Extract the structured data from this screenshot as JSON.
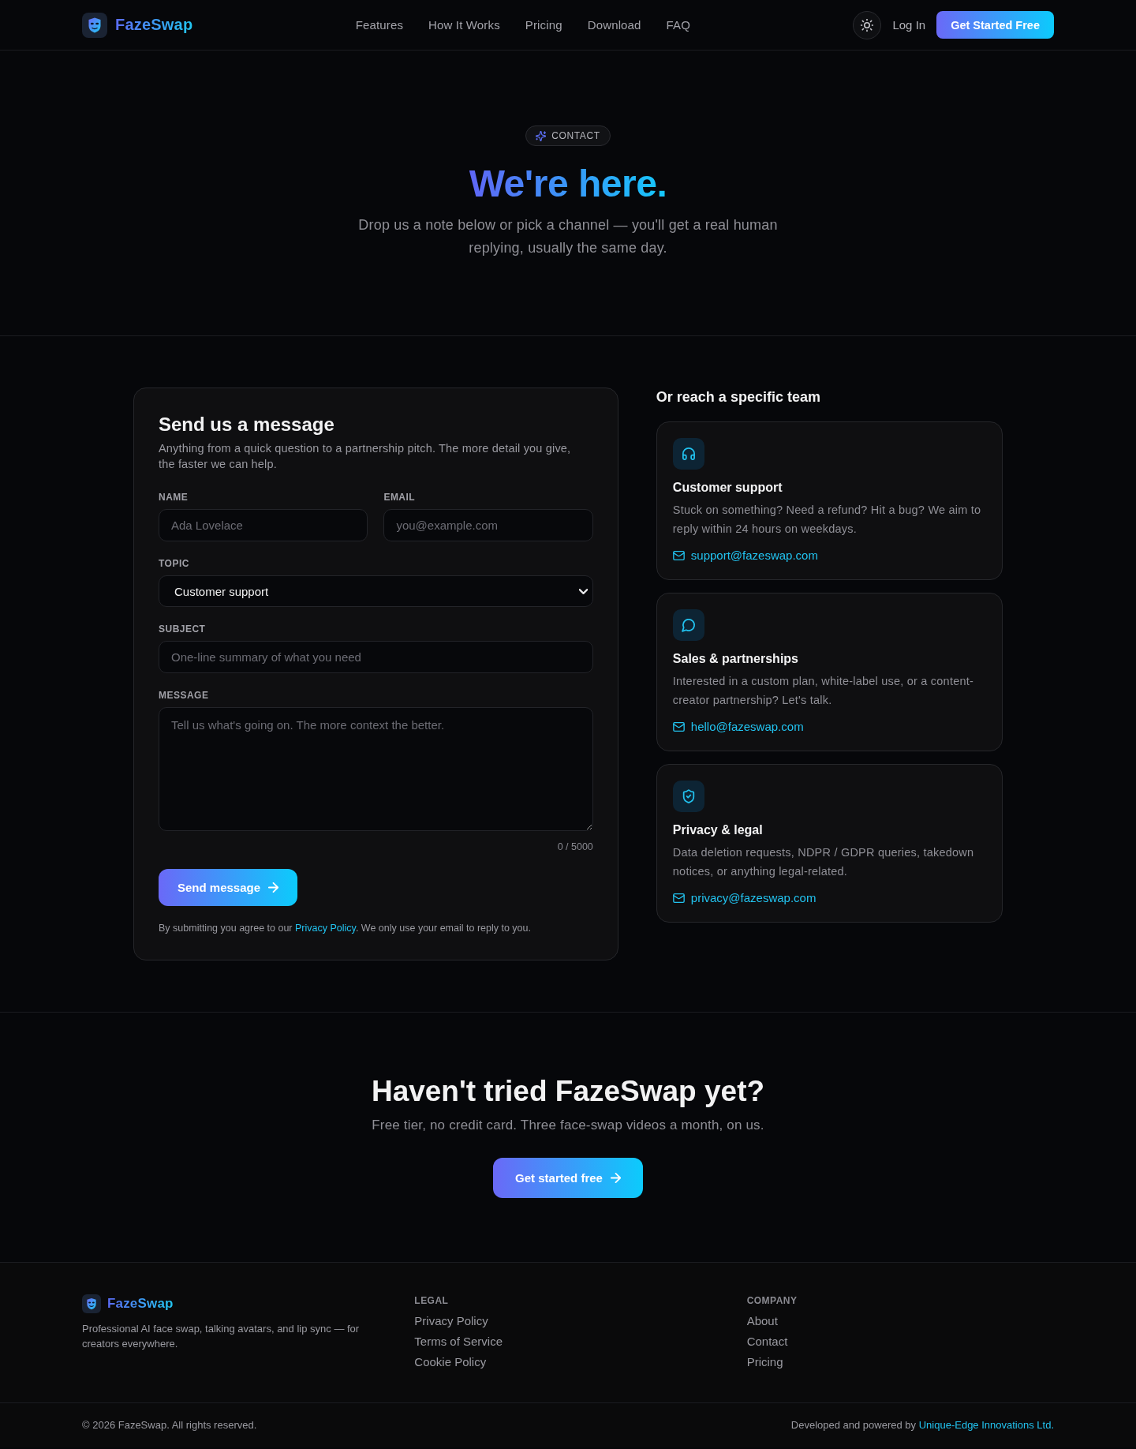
{
  "header": {
    "brand": "FazeSwap",
    "nav": [
      "Features",
      "How It Works",
      "Pricing",
      "Download",
      "FAQ"
    ],
    "login": "Log In",
    "cta": "Get Started Free"
  },
  "hero": {
    "badge": "CONTACT",
    "title": "We're here.",
    "subtitle": "Drop us a note below or pick a channel — you'll get a real human replying, usually the same day."
  },
  "form": {
    "title": "Send us a message",
    "description": "Anything from a quick question to a partnership pitch. The more detail you give, the faster we can help.",
    "rows": [
      [
        {
          "kind": "text",
          "label": "NAME",
          "placeholder": "Ada Lovelace"
        },
        {
          "kind": "email",
          "label": "EMAIL",
          "placeholder": "you@example.com"
        }
      ],
      [
        {
          "kind": "select",
          "label": "TOPIC",
          "value": "Customer support"
        }
      ],
      [
        {
          "kind": "text",
          "label": "SUBJECT",
          "placeholder": "One-line summary of what you need"
        }
      ],
      [
        {
          "kind": "textarea",
          "label": "MESSAGE",
          "placeholder": "Tell us what's going on. The more context the better.",
          "counter": "0 / 5000"
        }
      ]
    ],
    "submit": "Send message",
    "consent": {
      "before": "By submitting you agree to our",
      "link": "Privacy Policy",
      "after": ". We only use your email to reply to you."
    }
  },
  "teams": {
    "heading": "Or reach a specific team",
    "cards": [
      {
        "kind": "support",
        "title": "Customer support",
        "description": "Stuck on something? Need a refund? Hit a bug? We aim to reply within 24 hours on weekdays.",
        "email": "support@fazeswap.com"
      },
      {
        "kind": "sales",
        "title": "Sales & partnerships",
        "description": "Interested in a custom plan, white-label use, or a content-creator partnership? Let's talk.",
        "email": "hello@fazeswap.com"
      },
      {
        "kind": "legal",
        "title": "Privacy & legal",
        "description": "Data deletion requests, NDPR / GDPR queries, takedown notices, or anything legal-related.",
        "email": "privacy@fazeswap.com"
      }
    ]
  },
  "cta": {
    "title": "Haven't tried FazeSwap yet?",
    "subtitle": "Free tier, no credit card. Three face-swap videos a month, on us.",
    "button": "Get started free"
  },
  "footer": {
    "brand": "FazeSwap",
    "description": "Professional AI face swap, talking avatars, and lip sync — for creators everywhere.",
    "columns": [
      {
        "heading": "LEGAL",
        "links": [
          "Privacy Policy",
          "Terms of Service",
          "Cookie Policy"
        ]
      },
      {
        "heading": "COMPANY",
        "links": [
          "About",
          "Contact",
          "Pricing"
        ]
      }
    ],
    "copyright": "© 2026 FazeSwap. All rights reserved.",
    "credit": {
      "text": "Developed and powered by",
      "link": "Unique-Edge Innovations Ltd."
    }
  }
}
